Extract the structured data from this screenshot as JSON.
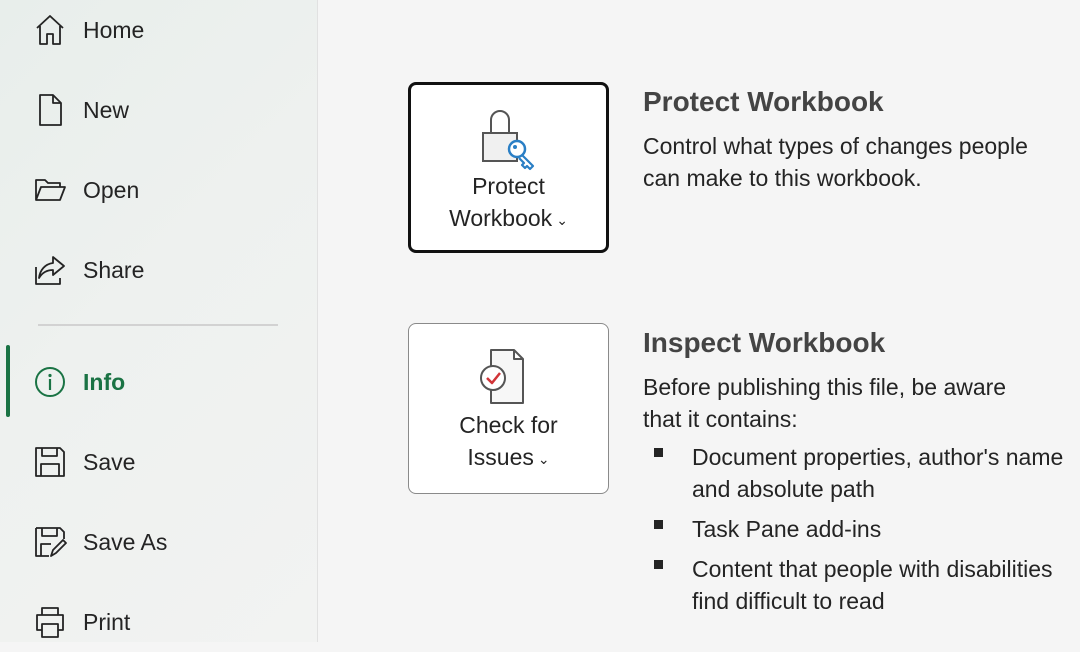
{
  "sidebar": {
    "items": [
      {
        "label": "Home",
        "icon": "home-icon"
      },
      {
        "label": "New",
        "icon": "new-document-icon"
      },
      {
        "label": "Open",
        "icon": "folder-open-icon"
      },
      {
        "label": "Share",
        "icon": "share-icon"
      },
      {
        "label": "Info",
        "icon": "info-icon",
        "active": true
      },
      {
        "label": "Save",
        "icon": "save-icon"
      },
      {
        "label": "Save As",
        "icon": "save-as-icon"
      },
      {
        "label": "Print",
        "icon": "print-icon"
      }
    ],
    "accent_color": "#1a7344"
  },
  "protect": {
    "button_line1": "Protect",
    "button_line2": "Workbook",
    "title": "Protect Workbook",
    "description": "Control what types of changes people can make to this workbook."
  },
  "inspect": {
    "button_line1": "Check for",
    "button_line2": "Issues",
    "title": "Inspect Workbook",
    "description": "Before publishing this file, be aware that it contains:",
    "bullets": [
      "Document properties, author's name and absolute path",
      "Task Pane add-ins",
      "Content that people with disabilities find difficult to read"
    ]
  }
}
